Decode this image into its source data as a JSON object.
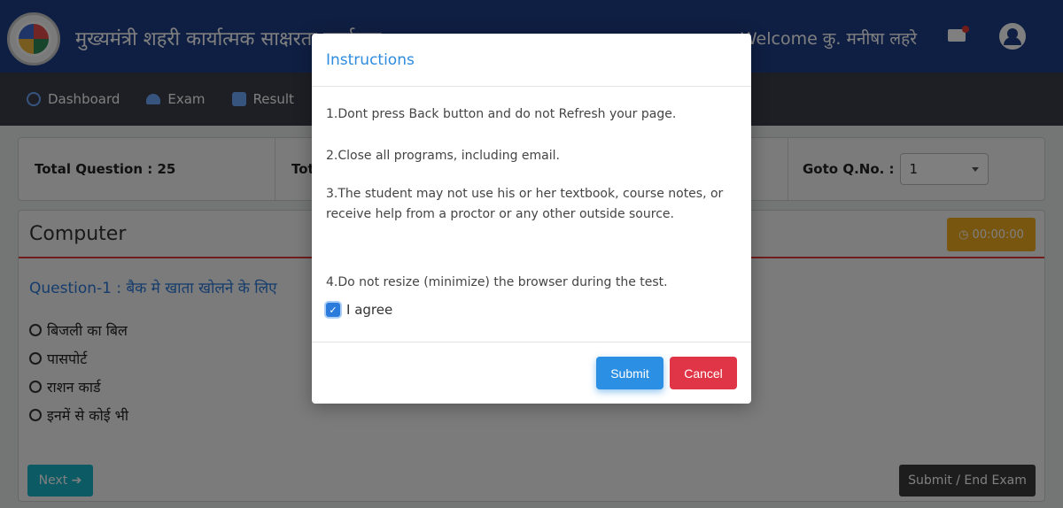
{
  "header": {
    "site_title": "मुख्यमंत्री शहरी कार्यात्मक साक्षरता कार्यक्रम",
    "welcome": "Welcome कु. मनीषा लहरे"
  },
  "nav": {
    "items": [
      {
        "label": "Dashboard",
        "icon": "dashboard-icon"
      },
      {
        "label": "Exam",
        "icon": "exam-icon"
      },
      {
        "label": "Result",
        "icon": "result-icon"
      }
    ]
  },
  "stats": {
    "total_question": "Total Question : 25",
    "total_partial": "Tot",
    "goto_label": "Goto Q.No. :",
    "goto_value": "1"
  },
  "question_panel": {
    "subject": "Computer",
    "timer": "00:00:00",
    "question": "Question-1 : बैक मे खाता खोलने के लिए",
    "options": [
      "बिजली का बिल",
      "पासपोर्ट",
      "राशन कार्ड",
      "इनमें से कोई भी"
    ],
    "next_label": "Next ➔",
    "end_label": "Submit / End Exam"
  },
  "modal": {
    "title": "Instructions",
    "instructions": [
      "1.Dont press Back button and do not Refresh your page.",
      "2.Close all programs, including email.",
      "3.The student may not use his or her textbook, course notes, or receive help from a proctor or any other outside source.",
      "4.Do not resize (minimize) the browser during the test."
    ],
    "agree_label": "I agree",
    "agree_checked": true,
    "submit_label": "Submit",
    "cancel_label": "Cancel"
  },
  "colors": {
    "header_bg": "#1f3f87",
    "nav_bg": "#3b3f4a",
    "modal_title": "#2d8be0",
    "submit": "#2b8fe3",
    "cancel": "#e03546",
    "timer": "#f0ad1e",
    "next": "#18b6c9"
  }
}
